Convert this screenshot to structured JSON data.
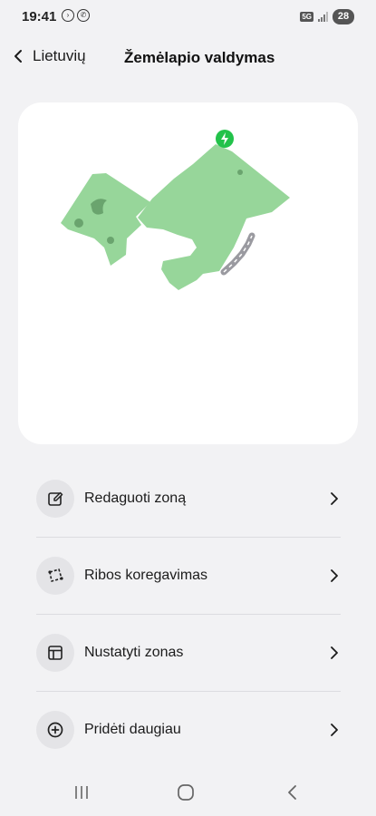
{
  "status_bar": {
    "time": "19:41",
    "network": "5G",
    "battery": "28"
  },
  "header": {
    "back_label": "Lietuvių",
    "title": "Žemėlapio valdymas"
  },
  "map": {
    "lawn_color": "#97d69a",
    "station_color": "#22c24a",
    "path_color": "#9a9aa0"
  },
  "menu": {
    "items": [
      {
        "label": "Redaguoti zoną",
        "icon": "edit-icon"
      },
      {
        "label": "Ribos koregavimas",
        "icon": "boundary-icon"
      },
      {
        "label": "Nustatyti zonas",
        "icon": "layout-icon"
      },
      {
        "label": "Pridėti daugiau",
        "icon": "add-circle-icon"
      }
    ]
  },
  "nav": {
    "recents": "recents-icon",
    "home": "home-icon",
    "back": "back-nav-icon"
  }
}
